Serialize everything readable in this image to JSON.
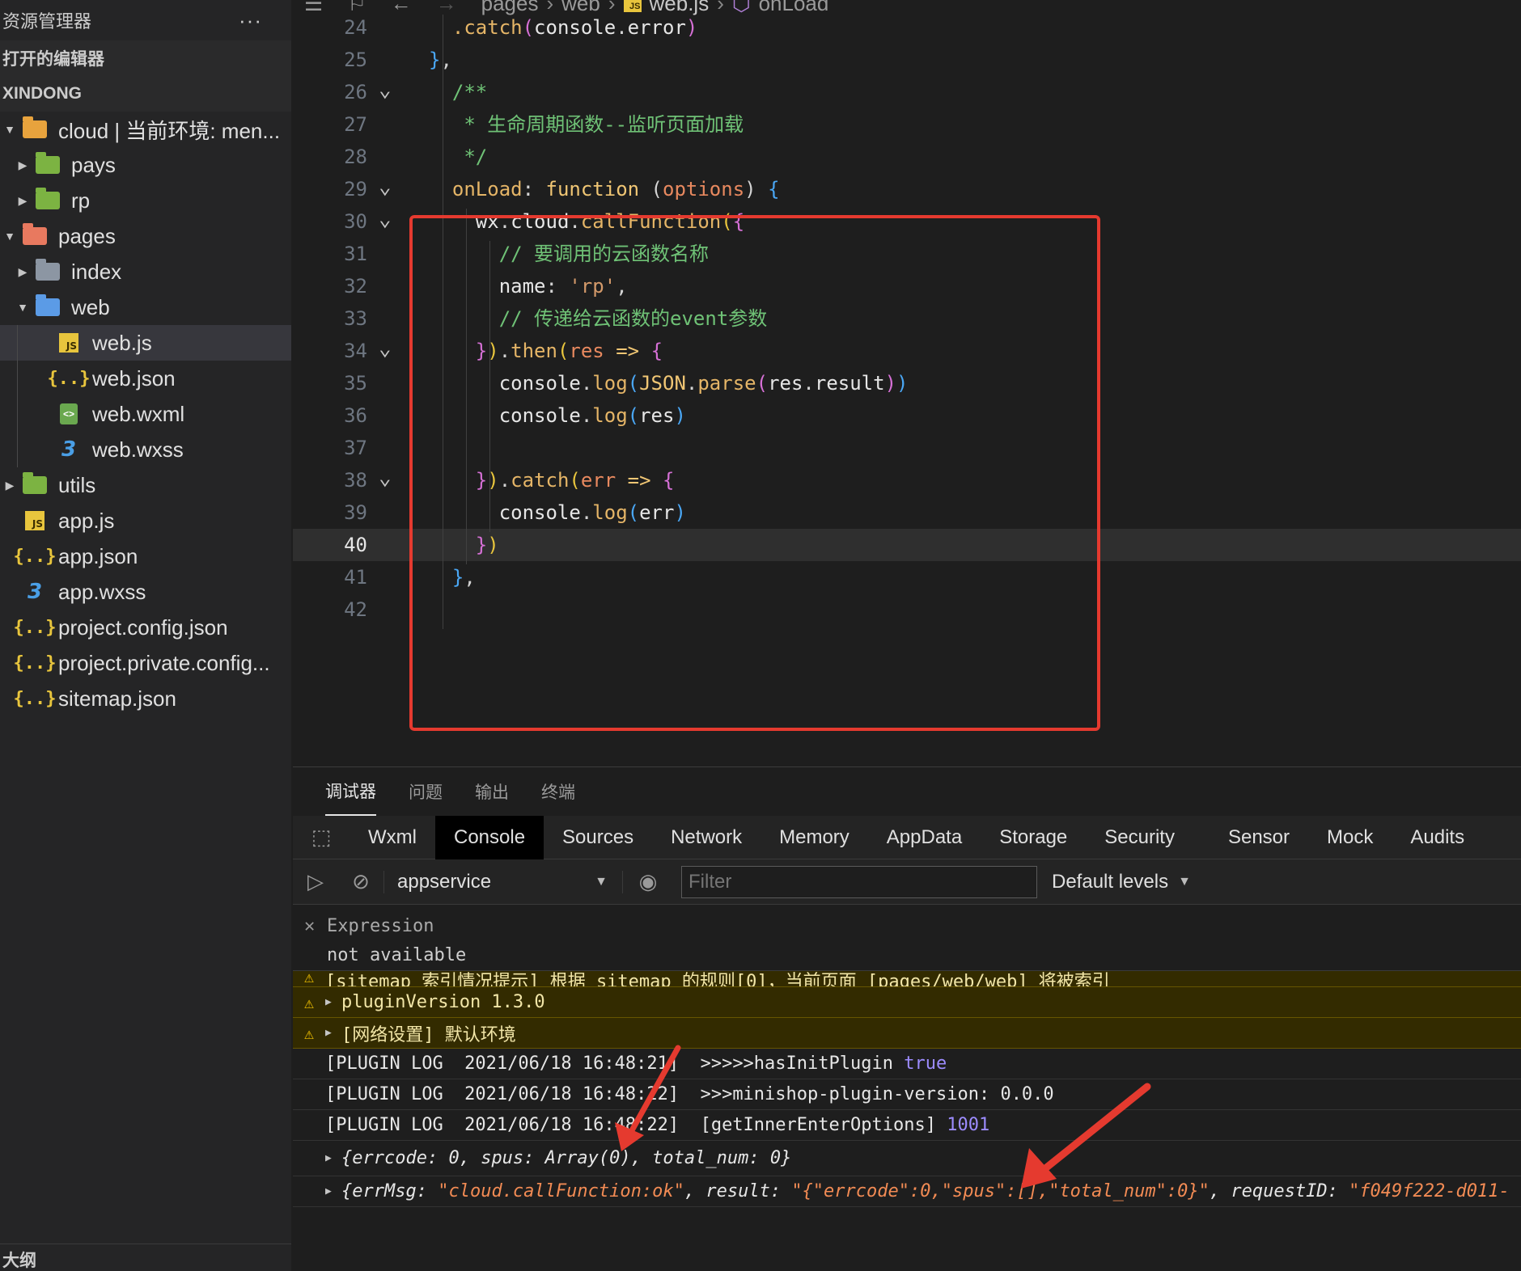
{
  "sidebar": {
    "title": "资源管理器",
    "more": "···",
    "open_editors": "打开的编辑器",
    "project": "XINDONG",
    "tree": [
      {
        "label": "cloud | 当前环境: men...",
        "depth": 0,
        "kind": "folder-cloud",
        "twisty": "▼"
      },
      {
        "label": "pays",
        "depth": 1,
        "kind": "folder-green",
        "twisty": "▶"
      },
      {
        "label": "rp",
        "depth": 1,
        "kind": "folder-green",
        "twisty": "▶"
      },
      {
        "label": "pages",
        "depth": 0,
        "kind": "folder-orange",
        "twisty": "▼"
      },
      {
        "label": "index",
        "depth": 1,
        "kind": "folder-grey",
        "twisty": "▶"
      },
      {
        "label": "web",
        "depth": 1,
        "kind": "folder-blue",
        "twisty": "▼"
      },
      {
        "label": "web.js",
        "depth": 2,
        "kind": "js",
        "twisty": "",
        "selected": true
      },
      {
        "label": "web.json",
        "depth": 2,
        "kind": "json",
        "twisty": ""
      },
      {
        "label": "web.wxml",
        "depth": 2,
        "kind": "wxml",
        "twisty": ""
      },
      {
        "label": "web.wxss",
        "depth": 2,
        "kind": "css",
        "twisty": ""
      },
      {
        "label": "utils",
        "depth": 0,
        "kind": "folder-green",
        "twisty": "▶"
      },
      {
        "label": "app.js",
        "depth": 0,
        "kind": "js",
        "twisty": ""
      },
      {
        "label": "app.json",
        "depth": 0,
        "kind": "json",
        "twisty": ""
      },
      {
        "label": "app.wxss",
        "depth": 0,
        "kind": "css",
        "twisty": ""
      },
      {
        "label": "project.config.json",
        "depth": 0,
        "kind": "json",
        "twisty": ""
      },
      {
        "label": "project.private.config...",
        "depth": 0,
        "kind": "json",
        "twisty": ""
      },
      {
        "label": "sitemap.json",
        "depth": 0,
        "kind": "json",
        "twisty": ""
      }
    ],
    "outline": "大纲"
  },
  "breadcrumb": [
    "pages",
    "web",
    "web.js",
    "onLoad"
  ],
  "editor": {
    "current_line": "40",
    "lines": [
      {
        "n": "24",
        "fold": false
      },
      {
        "n": "25",
        "fold": false
      },
      {
        "n": "26",
        "fold": true
      },
      {
        "n": "27",
        "fold": false
      },
      {
        "n": "28",
        "fold": false
      },
      {
        "n": "29",
        "fold": true
      },
      {
        "n": "30",
        "fold": true
      },
      {
        "n": "31",
        "fold": false
      },
      {
        "n": "32",
        "fold": false
      },
      {
        "n": "33",
        "fold": false
      },
      {
        "n": "34",
        "fold": true
      },
      {
        "n": "35",
        "fold": false
      },
      {
        "n": "36",
        "fold": false
      },
      {
        "n": "37",
        "fold": false
      },
      {
        "n": "38",
        "fold": true
      },
      {
        "n": "39",
        "fold": false
      },
      {
        "n": "40",
        "fold": false
      },
      {
        "n": "41",
        "fold": false
      },
      {
        "n": "42",
        "fold": false
      }
    ],
    "code": {
      "l24": [
        ".catch",
        "(",
        "console",
        ".",
        "error",
        ")"
      ],
      "l25": [
        "}",
        ","
      ],
      "l26": "/**",
      "l27": " * 生命周期函数--监听页面加载",
      "l28": " */",
      "l29": [
        "onLoad",
        ": ",
        "function",
        " (",
        "options",
        ") ",
        "{"
      ],
      "l30": [
        "wx",
        ".",
        "cloud",
        ".",
        "callFunction",
        "(",
        "{"
      ],
      "l31": "// 要调用的云函数名称",
      "l32": [
        "name",
        ": ",
        "'rp'",
        ","
      ],
      "l33": "// 传递给云函数的event参数",
      "l34": [
        "}",
        ")",
        ".",
        "then",
        "(",
        "res",
        " => ",
        "{"
      ],
      "l35": [
        "console",
        ".",
        "log",
        "(",
        "JSON",
        ".",
        "parse",
        "(",
        "res",
        ".",
        "result",
        ")",
        ")"
      ],
      "l36": [
        "console",
        ".",
        "log",
        "(",
        "res",
        ")"
      ],
      "l38": [
        "}",
        ")",
        ".",
        "catch",
        "(",
        "err",
        " => ",
        "{"
      ],
      "l39": [
        "console",
        ".",
        "log",
        "(",
        "err",
        ")"
      ],
      "l40": [
        "}",
        ")"
      ],
      "l41": [
        "}",
        ","
      ]
    }
  },
  "panel": {
    "tabs": [
      "调试器",
      "问题",
      "输出",
      "终端"
    ],
    "active_tab": "调试器",
    "devtools_tabs": [
      "Wxml",
      "Console",
      "Sources",
      "Network",
      "Memory",
      "AppData",
      "Storage",
      "Security",
      "Sensor",
      "Mock",
      "Audits"
    ],
    "active_devtool": "Console",
    "context": "appservice",
    "filter_placeholder": "Filter",
    "levels": "Default levels",
    "expression_label": "Expression",
    "expression_value": "not available"
  },
  "console": {
    "warn_partial": "[sitemap 索引情况提示] 根据 sitemap 的规则[0]，当前页面 [pages/web/web] 将被索引",
    "warn1": "pluginVersion 1.3.0",
    "warn2": "[网络设置] 默认环境",
    "log1_prefix": "[PLUGIN LOG  2021/06/18 16:48:21]  >>>>>hasInitPlugin ",
    "log1_value": "true",
    "log2": "[PLUGIN LOG  2021/06/18 16:48:22]  >>>minishop-plugin-version: 0.0.0",
    "log3_prefix": "[PLUGIN LOG  2021/06/18 16:48:22]  [getInnerEnterOptions] ",
    "log3_value": "1001",
    "obj1": {
      "open": "{errcode: ",
      "errcode": "0",
      "mid": ", spus: Array(0), total_num: ",
      "total": "0",
      "close": "}"
    },
    "obj2": {
      "open": "{errMsg: ",
      "errmsg": "\"cloud.callFunction:ok\"",
      "mid": ", result: ",
      "result": "\"{\"errcode\":0,\"spus\":[],\"total_num\":0}\"",
      "mid2": ", requestID: ",
      "reqid": "\"f049f222-d011-"
    }
  },
  "colors": {
    "highlight_box": "#e53a2f",
    "arrow": "#e53a2f"
  }
}
